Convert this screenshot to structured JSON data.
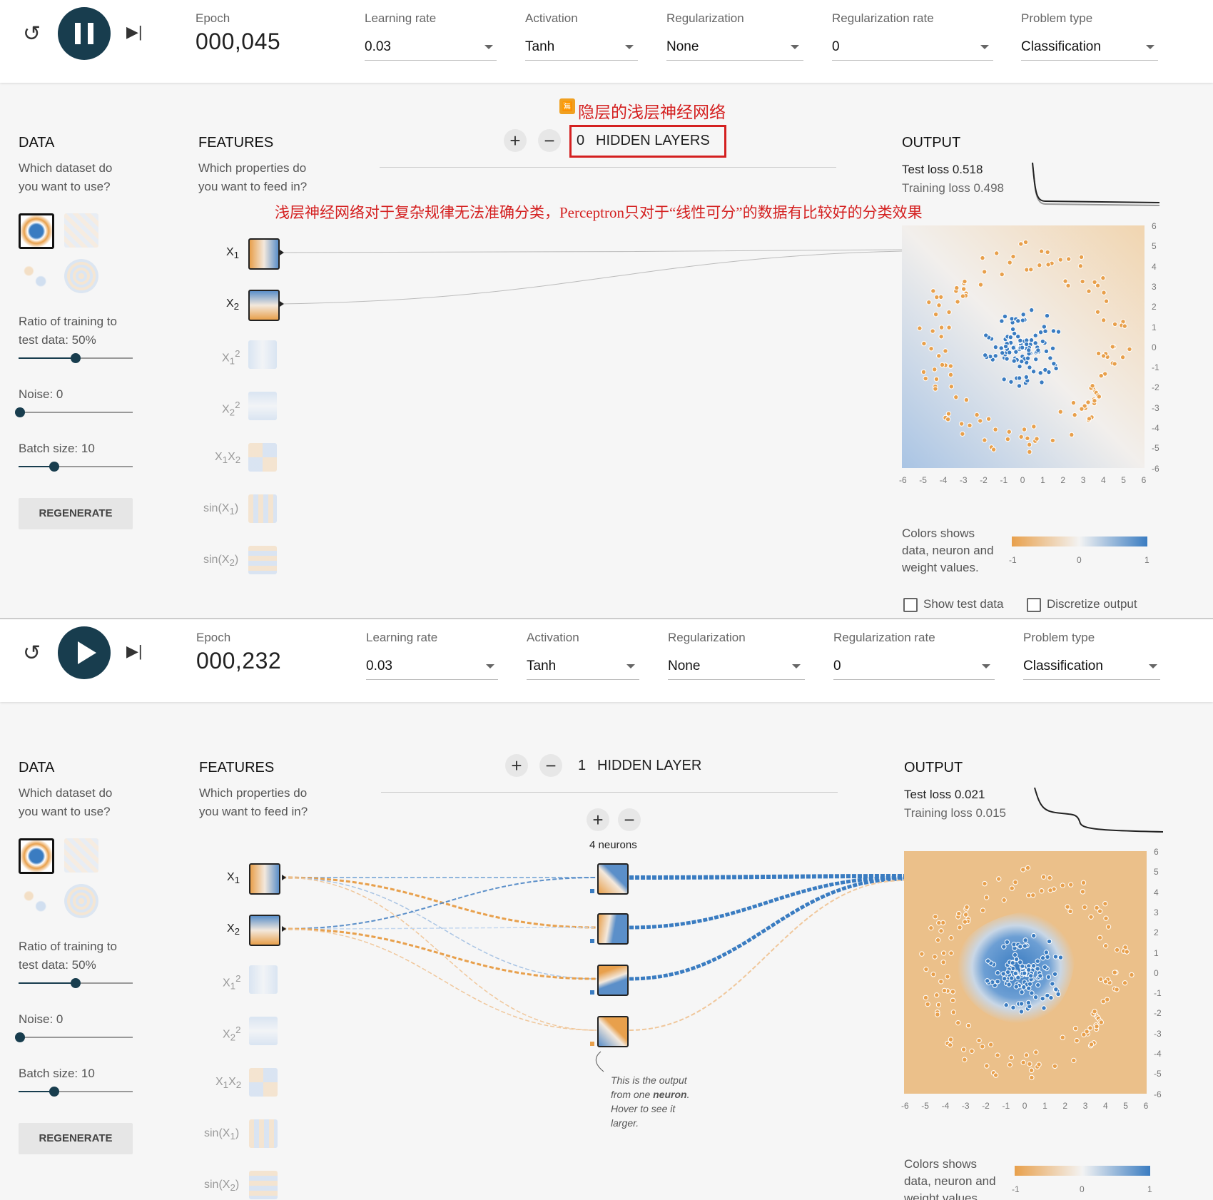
{
  "annotations": {
    "title": "隐层的浅层神经网络",
    "caption": "浅层神经网络对于复杂规律无法准确分类，Perceptron只对于“线性可分”的数据有比较好的分类效果"
  },
  "common": {
    "epoch_label": "Epoch",
    "learning_rate_label": "Learning rate",
    "learning_rate": "0.03",
    "activation_label": "Activation",
    "activation": "Tanh",
    "regularization_label": "Regularization",
    "regularization": "None",
    "regularization_rate_label": "Regularization rate",
    "regularization_rate": "0",
    "problem_type_label": "Problem type",
    "problem_type": "Classification",
    "data_title": "DATA",
    "data_sub1": "Which dataset do",
    "data_sub2": "you want to use?",
    "ratio_label1": "Ratio of training to",
    "ratio_label2": "test data:  50%",
    "ratio_value": 0.5,
    "noise_label": "Noise:  0",
    "noise_value": 0,
    "batch_label": "Batch size:  10",
    "batch_value": 0.3,
    "regenerate": "REGENERATE",
    "features_title": "FEATURES",
    "features_sub1": "Which properties do",
    "features_sub2": "you want to feed in?",
    "output_title": "OUTPUT",
    "colors_text1": "Colors shows",
    "colors_text2": "data, neuron and",
    "colors_text3": "weight values.",
    "legend_ticks": [
      "-1",
      "0",
      "1"
    ],
    "plot_y_ticks": [
      "6",
      "5",
      "4",
      "3",
      "2",
      "1",
      "0",
      "-1",
      "-2",
      "-3",
      "-4",
      "-5",
      "-6"
    ],
    "plot_x_ticks": [
      "-6",
      "-5",
      "-4",
      "-3",
      "-2",
      "-1",
      "0",
      "1",
      "2",
      "3",
      "4",
      "5",
      "6"
    ],
    "show_test_data": "Show test data",
    "discretize_output": "Discretize output",
    "plus": "+",
    "minus": "−"
  },
  "panel1": {
    "epoch": "000,045",
    "hidden_count": "0",
    "hidden_label": "HIDDEN LAYERS",
    "test_loss": "Test loss 0.518",
    "training_loss": "Training loss 0.498"
  },
  "panel2": {
    "epoch": "000,232",
    "hidden_count": "1",
    "hidden_label": "HIDDEN LAYER",
    "test_loss": "Test loss 0.021",
    "training_loss": "Training loss 0.015",
    "neurons_label": "4 neurons",
    "tooltip1": "This is the output",
    "tooltip2": "from one ",
    "tooltip2b": "neuron",
    "tooltip2c": ".",
    "tooltip3": "Hover to see it",
    "tooltip4": "larger."
  },
  "colors": {
    "orange": "#e8a04c",
    "blue": "#3a7cc1",
    "dark": "#183d4e"
  }
}
